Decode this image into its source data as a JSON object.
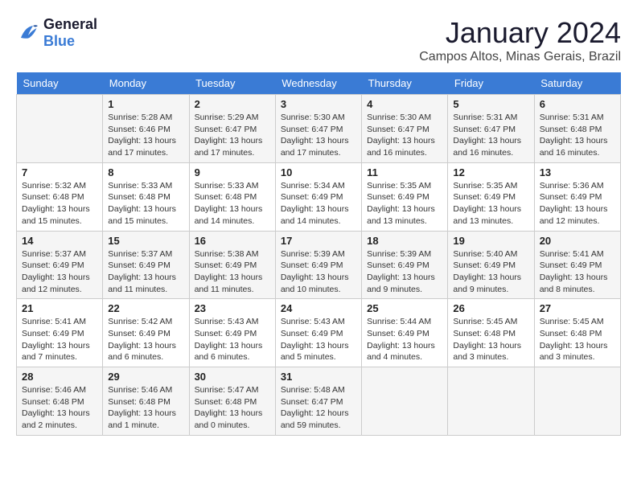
{
  "logo": {
    "line1": "General",
    "line2": "Blue"
  },
  "title": "January 2024",
  "subtitle": "Campos Altos, Minas Gerais, Brazil",
  "days_of_week": [
    "Sunday",
    "Monday",
    "Tuesday",
    "Wednesday",
    "Thursday",
    "Friday",
    "Saturday"
  ],
  "weeks": [
    [
      {
        "day": "",
        "info": ""
      },
      {
        "day": "1",
        "info": "Sunrise: 5:28 AM\nSunset: 6:46 PM\nDaylight: 13 hours\nand 17 minutes."
      },
      {
        "day": "2",
        "info": "Sunrise: 5:29 AM\nSunset: 6:47 PM\nDaylight: 13 hours\nand 17 minutes."
      },
      {
        "day": "3",
        "info": "Sunrise: 5:30 AM\nSunset: 6:47 PM\nDaylight: 13 hours\nand 17 minutes."
      },
      {
        "day": "4",
        "info": "Sunrise: 5:30 AM\nSunset: 6:47 PM\nDaylight: 13 hours\nand 16 minutes."
      },
      {
        "day": "5",
        "info": "Sunrise: 5:31 AM\nSunset: 6:47 PM\nDaylight: 13 hours\nand 16 minutes."
      },
      {
        "day": "6",
        "info": "Sunrise: 5:31 AM\nSunset: 6:48 PM\nDaylight: 13 hours\nand 16 minutes."
      }
    ],
    [
      {
        "day": "7",
        "info": "Sunrise: 5:32 AM\nSunset: 6:48 PM\nDaylight: 13 hours\nand 15 minutes."
      },
      {
        "day": "8",
        "info": "Sunrise: 5:33 AM\nSunset: 6:48 PM\nDaylight: 13 hours\nand 15 minutes."
      },
      {
        "day": "9",
        "info": "Sunrise: 5:33 AM\nSunset: 6:48 PM\nDaylight: 13 hours\nand 14 minutes."
      },
      {
        "day": "10",
        "info": "Sunrise: 5:34 AM\nSunset: 6:49 PM\nDaylight: 13 hours\nand 14 minutes."
      },
      {
        "day": "11",
        "info": "Sunrise: 5:35 AM\nSunset: 6:49 PM\nDaylight: 13 hours\nand 13 minutes."
      },
      {
        "day": "12",
        "info": "Sunrise: 5:35 AM\nSunset: 6:49 PM\nDaylight: 13 hours\nand 13 minutes."
      },
      {
        "day": "13",
        "info": "Sunrise: 5:36 AM\nSunset: 6:49 PM\nDaylight: 13 hours\nand 12 minutes."
      }
    ],
    [
      {
        "day": "14",
        "info": "Sunrise: 5:37 AM\nSunset: 6:49 PM\nDaylight: 13 hours\nand 12 minutes."
      },
      {
        "day": "15",
        "info": "Sunrise: 5:37 AM\nSunset: 6:49 PM\nDaylight: 13 hours\nand 11 minutes."
      },
      {
        "day": "16",
        "info": "Sunrise: 5:38 AM\nSunset: 6:49 PM\nDaylight: 13 hours\nand 11 minutes."
      },
      {
        "day": "17",
        "info": "Sunrise: 5:39 AM\nSunset: 6:49 PM\nDaylight: 13 hours\nand 10 minutes."
      },
      {
        "day": "18",
        "info": "Sunrise: 5:39 AM\nSunset: 6:49 PM\nDaylight: 13 hours\nand 9 minutes."
      },
      {
        "day": "19",
        "info": "Sunrise: 5:40 AM\nSunset: 6:49 PM\nDaylight: 13 hours\nand 9 minutes."
      },
      {
        "day": "20",
        "info": "Sunrise: 5:41 AM\nSunset: 6:49 PM\nDaylight: 13 hours\nand 8 minutes."
      }
    ],
    [
      {
        "day": "21",
        "info": "Sunrise: 5:41 AM\nSunset: 6:49 PM\nDaylight: 13 hours\nand 7 minutes."
      },
      {
        "day": "22",
        "info": "Sunrise: 5:42 AM\nSunset: 6:49 PM\nDaylight: 13 hours\nand 6 minutes."
      },
      {
        "day": "23",
        "info": "Sunrise: 5:43 AM\nSunset: 6:49 PM\nDaylight: 13 hours\nand 6 minutes."
      },
      {
        "day": "24",
        "info": "Sunrise: 5:43 AM\nSunset: 6:49 PM\nDaylight: 13 hours\nand 5 minutes."
      },
      {
        "day": "25",
        "info": "Sunrise: 5:44 AM\nSunset: 6:49 PM\nDaylight: 13 hours\nand 4 minutes."
      },
      {
        "day": "26",
        "info": "Sunrise: 5:45 AM\nSunset: 6:48 PM\nDaylight: 13 hours\nand 3 minutes."
      },
      {
        "day": "27",
        "info": "Sunrise: 5:45 AM\nSunset: 6:48 PM\nDaylight: 13 hours\nand 3 minutes."
      }
    ],
    [
      {
        "day": "28",
        "info": "Sunrise: 5:46 AM\nSunset: 6:48 PM\nDaylight: 13 hours\nand 2 minutes."
      },
      {
        "day": "29",
        "info": "Sunrise: 5:46 AM\nSunset: 6:48 PM\nDaylight: 13 hours\nand 1 minute."
      },
      {
        "day": "30",
        "info": "Sunrise: 5:47 AM\nSunset: 6:48 PM\nDaylight: 13 hours\nand 0 minutes."
      },
      {
        "day": "31",
        "info": "Sunrise: 5:48 AM\nSunset: 6:47 PM\nDaylight: 12 hours\nand 59 minutes."
      },
      {
        "day": "",
        "info": ""
      },
      {
        "day": "",
        "info": ""
      },
      {
        "day": "",
        "info": ""
      }
    ]
  ]
}
